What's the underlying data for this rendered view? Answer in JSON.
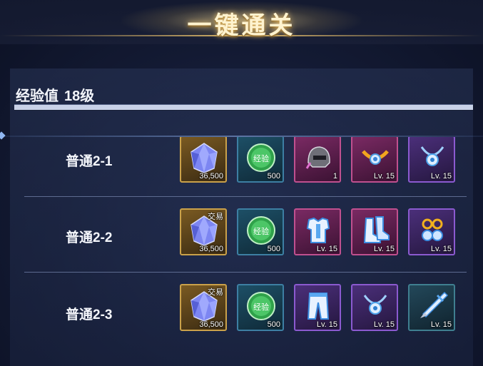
{
  "header": {
    "title": "一键通关"
  },
  "experience": {
    "label": "经验值",
    "level": "18级",
    "progress": 1.0
  },
  "rows": [
    {
      "stage": "普通2-1",
      "rewards": [
        {
          "icon": "crystal-icon",
          "qty": "36,500",
          "tag": ""
        },
        {
          "icon": "exp-orb-icon",
          "qty": "500",
          "badge": "经验"
        },
        {
          "icon": "helmet-icon",
          "qty": "1"
        },
        {
          "icon": "belt-icon",
          "qty": "Lv. 15"
        },
        {
          "icon": "necklace-icon",
          "qty": "Lv. 15"
        }
      ]
    },
    {
      "stage": "普通2-2",
      "rewards": [
        {
          "icon": "crystal-icon",
          "qty": "36,500",
          "tag": "交易"
        },
        {
          "icon": "exp-orb-icon",
          "qty": "500",
          "badge": "经验"
        },
        {
          "icon": "armor-icon",
          "qty": "Lv. 15"
        },
        {
          "icon": "boots-icon",
          "qty": "Lv. 15"
        },
        {
          "icon": "earring-icon",
          "qty": "Lv. 15"
        }
      ]
    },
    {
      "stage": "普通2-3",
      "rewards": [
        {
          "icon": "crystal-icon",
          "qty": "36,500",
          "tag": "交易"
        },
        {
          "icon": "exp-orb-icon",
          "qty": "500",
          "badge": "经验"
        },
        {
          "icon": "pants-icon",
          "qty": "Lv. 15"
        },
        {
          "icon": "necklace-icon",
          "qty": "Lv. 15"
        },
        {
          "icon": "weapon-icon",
          "qty": "Lv. 15"
        }
      ]
    }
  ]
}
